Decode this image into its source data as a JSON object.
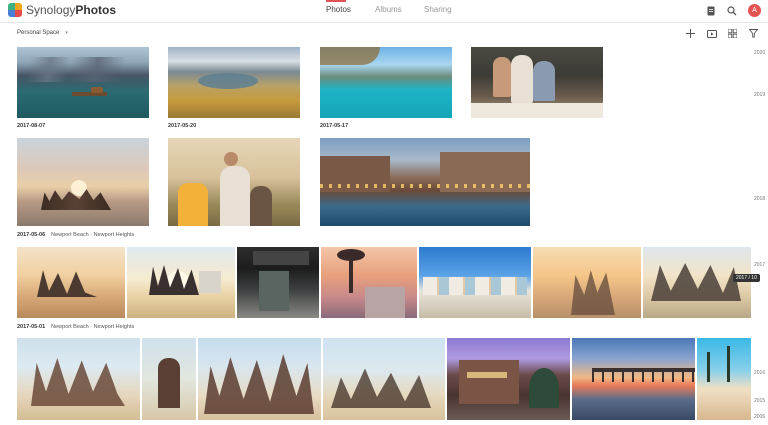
{
  "app": {
    "title_light": "Synology",
    "title_bold": "Photos"
  },
  "tabs": [
    {
      "label": "Photos",
      "active": true
    },
    {
      "label": "Albums",
      "active": false
    },
    {
      "label": "Sharing",
      "active": false
    }
  ],
  "user": {
    "avatar_letter": "A"
  },
  "space_selector": {
    "label": "Personal Space"
  },
  "groups": [
    {
      "date": "2017-08-07",
      "location": ""
    },
    {
      "date": "2017-05-20",
      "location": ""
    },
    {
      "date": "2017-05-17",
      "location": ""
    },
    {
      "date": "2017-05-06",
      "location": "Newport Beach · Newport Heights"
    },
    {
      "date": "2017-05-01",
      "location": "Newport Beach · Newport Heights"
    }
  ],
  "timeline": {
    "years": [
      "2020",
      "2019",
      "2018",
      "2017",
      "2016",
      "2015",
      "2006"
    ],
    "tooltip": "2017 / 10"
  },
  "colors": {
    "accent": "#e05555",
    "avatar_bg": "#e55353"
  }
}
